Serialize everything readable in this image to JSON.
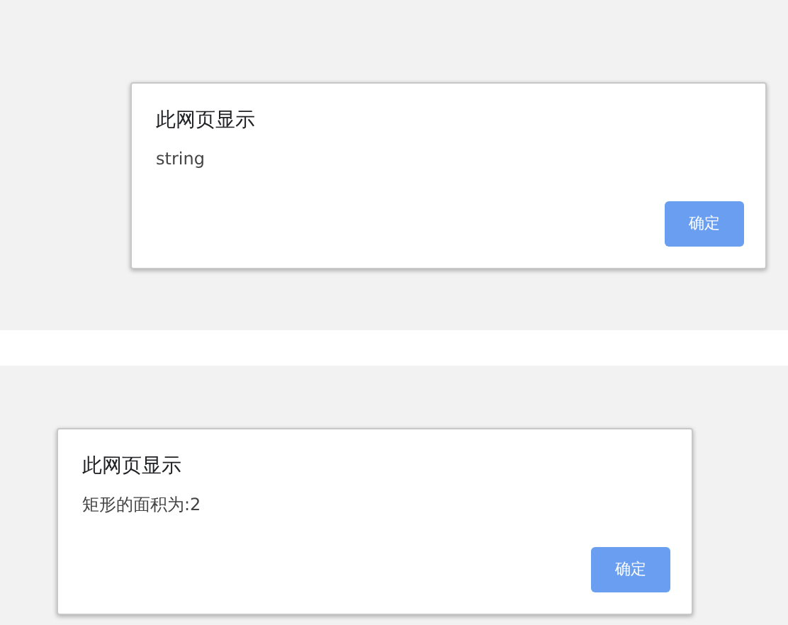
{
  "dialogs": [
    {
      "title": "此网页显示",
      "message": "string",
      "button": "确定"
    },
    {
      "title": "此网页显示",
      "message": "矩形的面积为:2",
      "button": "确定"
    }
  ]
}
